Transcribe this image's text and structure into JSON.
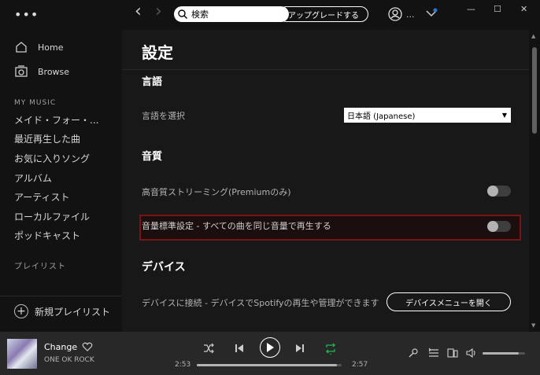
{
  "sidebar": {
    "menu_glyph": "•••",
    "nav": [
      {
        "label": "Home",
        "icon": "home-icon"
      },
      {
        "label": "Browse",
        "icon": "browse-icon"
      }
    ],
    "my_music_label": "MY MUSIC",
    "library": [
      "メイド・フォー・...",
      "最近再生した曲",
      "お気に入りソング",
      "アルバム",
      "アーティスト",
      "ローカルファイル",
      "ポッドキャスト"
    ],
    "playlists_label": "プレイリスト",
    "new_playlist_label": "新規プレイリスト"
  },
  "topbar": {
    "back_glyph": "‹",
    "forward_glyph": "›",
    "search_value": "検索",
    "upgrade_label": "アップグレードする",
    "user_label": "...",
    "minimize_glyph": "—",
    "maximize_glyph": "☐",
    "close_glyph": "✕",
    "notification_color": "#2e77d0"
  },
  "settings": {
    "title": "設定",
    "language": {
      "heading": "言語",
      "select_label": "言語を選択",
      "selected_value": "日本語 (Japanese)"
    },
    "quality": {
      "heading": "音質",
      "hq_label": "高音質ストリーミング(Premiumのみ)",
      "hq_on": false,
      "normalize_label": "音量標準設定 - すべての曲を同じ音量で再生する",
      "normalize_on": false
    },
    "devices": {
      "heading": "デバイス",
      "connect_label": "デバイスに接続 - デバイスでSpotifyの再生や管理ができます",
      "menu_button_label": "デバイスメニューを開く"
    }
  },
  "player": {
    "track_title": "Change",
    "artist": "ONE OK ROCK",
    "elapsed": "2:53",
    "duration": "2:57",
    "progress": 0.97,
    "volume": 0.85,
    "accent_color": "#1db954",
    "repeat_on": true
  }
}
